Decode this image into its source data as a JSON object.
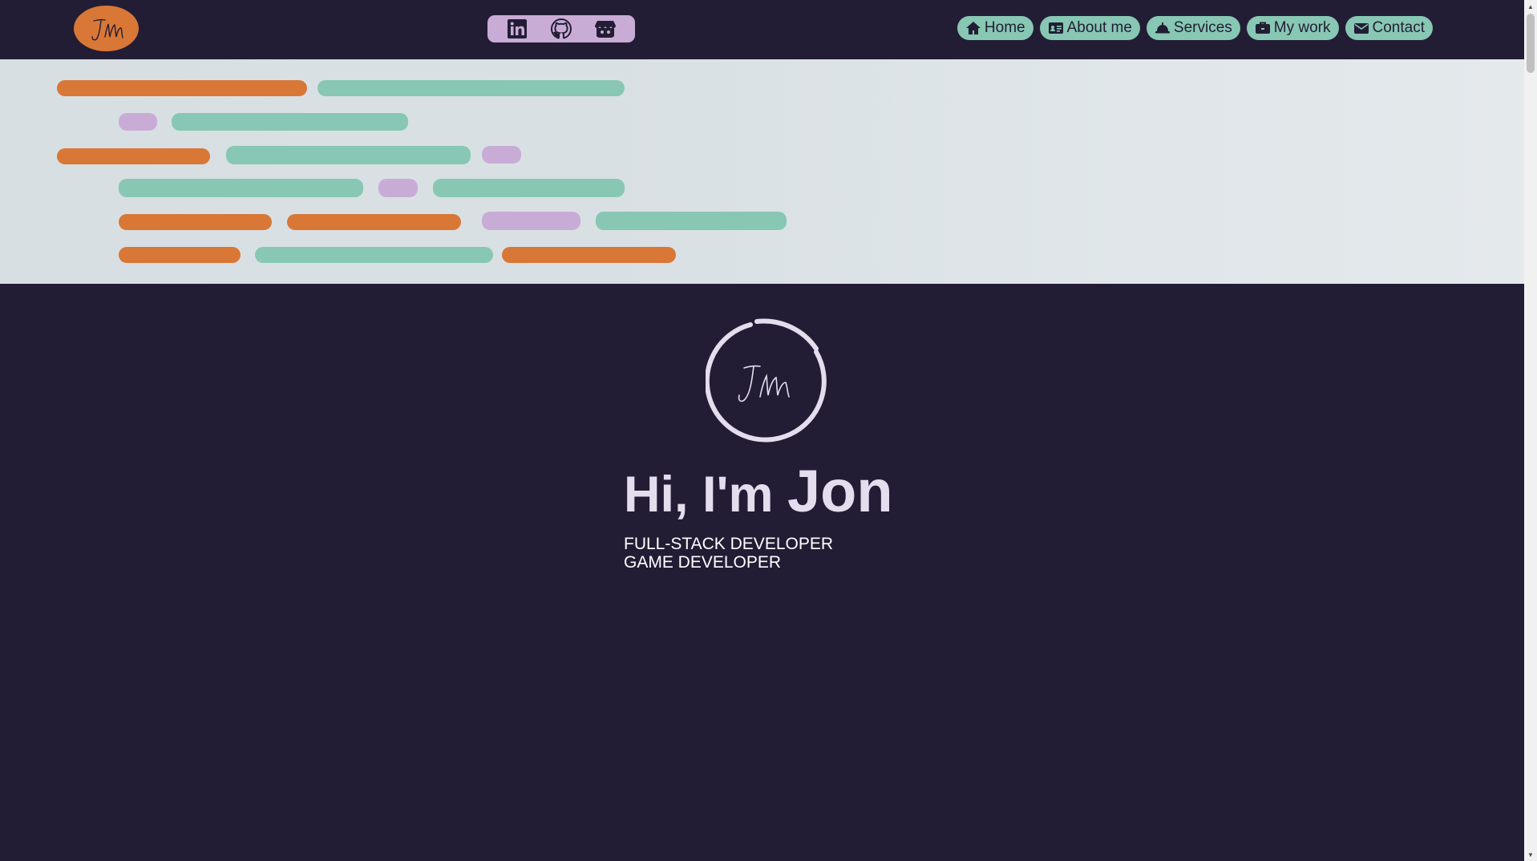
{
  "header": {
    "logo_text": "JM",
    "social": [
      {
        "icon": "linkedin-icon"
      },
      {
        "icon": "github-icon"
      },
      {
        "icon": "itchio-icon"
      }
    ],
    "nav": [
      {
        "label": "Home",
        "icon": "home-icon"
      },
      {
        "label": "About me",
        "icon": "id-card-icon"
      },
      {
        "label": "Services",
        "icon": "bell-icon"
      },
      {
        "label": "My work",
        "icon": "briefcase-icon"
      },
      {
        "label": "Contact",
        "icon": "envelope-icon"
      }
    ]
  },
  "hero": {
    "greeting": "Hi, I'm",
    "name": "Jon",
    "roles": [
      "FULL-STACK DEVELOPER",
      "GAME DEVELOPER"
    ]
  },
  "colors": {
    "background": "#221d35",
    "accent_orange": "#d97736",
    "accent_green": "#87c7b3",
    "accent_purple": "#c9acd6",
    "banner": "#d7dfe3",
    "text_light": "#e4dded"
  }
}
